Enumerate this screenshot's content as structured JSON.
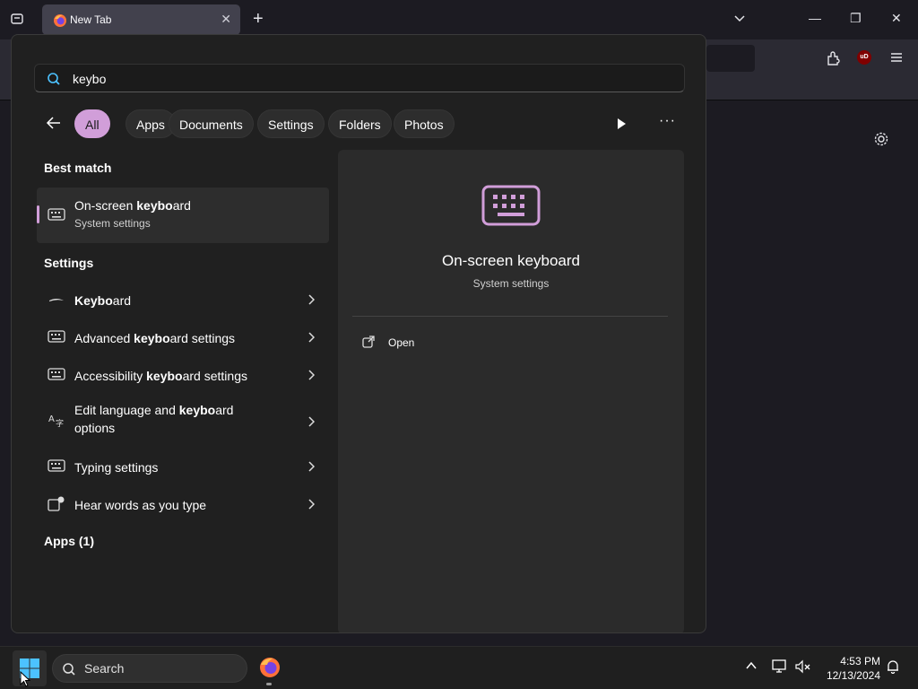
{
  "browser": {
    "tab_title": "New Tab",
    "close_glyph": "✕",
    "newtab_glyph": "+",
    "min_glyph": "—",
    "restore_glyph": "❐",
    "close_window_glyph": "✕",
    "ublock_label": "uD"
  },
  "search": {
    "query": "keybo"
  },
  "filters": [
    {
      "label": "All",
      "active": true
    },
    {
      "label": "Apps"
    },
    {
      "label": "Documents"
    },
    {
      "label": "Settings"
    },
    {
      "label": "Folders"
    },
    {
      "label": "Photos"
    }
  ],
  "more_glyph": "···",
  "sections": {
    "best_match": "Best match",
    "settings": "Settings",
    "apps": "Apps (1)"
  },
  "best_match": {
    "title_pre": "On-screen ",
    "title_bold": "keybo",
    "title_post": "ard",
    "subtitle": "System settings"
  },
  "settings_items": [
    {
      "pre": "",
      "bold": "Keybo",
      "post": "ard",
      "icon": "keyboard-swipe-icon"
    },
    {
      "pre": "Advanced ",
      "bold": "keybo",
      "post": "ard settings",
      "icon": "keyboard-icon"
    },
    {
      "pre": "Accessibility ",
      "bold": "keybo",
      "post": "ard settings",
      "icon": "keyboard-icon"
    },
    {
      "pre": "Edit language and ",
      "bold": "keybo",
      "post": "ard options",
      "icon": "language-icon"
    },
    {
      "pre": "Typing settings",
      "bold": "",
      "post": "",
      "icon": "keyboard-icon"
    },
    {
      "pre": "Hear words as you type",
      "bold": "",
      "post": "",
      "icon": "narrator-icon"
    }
  ],
  "detail": {
    "title": "On-screen keyboard",
    "subtitle": "System settings",
    "open_label": "Open"
  },
  "taskbar": {
    "search_label": "Search",
    "time": "4:53 PM",
    "date": "12/13/2024"
  },
  "colors": {
    "accent": "#d19ed9",
    "flyout_bg": "#202020",
    "detail_bg": "#2b2b2b"
  }
}
